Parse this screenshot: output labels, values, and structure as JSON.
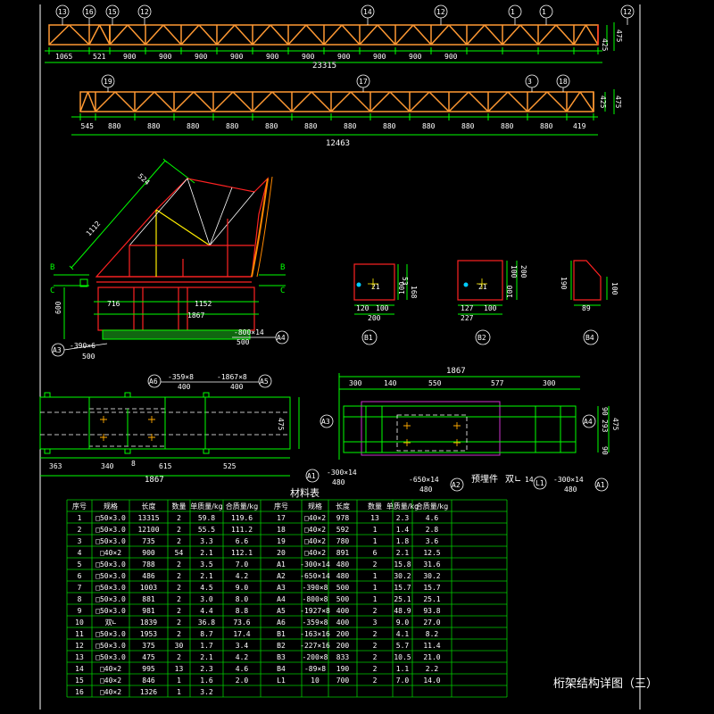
{
  "title": "桁架结构详图（三）",
  "truss1": {
    "markers": [
      "13",
      "16",
      "15",
      "12",
      "14",
      "12",
      "1",
      "1",
      "12"
    ],
    "dims": [
      "1065",
      "521",
      "900",
      "900",
      "900",
      "900",
      "900",
      "900",
      "900",
      "900",
      "900",
      "900"
    ],
    "total": "23315",
    "heights": [
      "425",
      "475"
    ]
  },
  "truss2": {
    "markers": [
      "19",
      "17",
      "3",
      "18"
    ],
    "dims": [
      "545",
      "880",
      "880",
      "880",
      "880",
      "880",
      "880",
      "880",
      "880",
      "880",
      "880",
      "880",
      "880",
      "419"
    ],
    "total": "12463",
    "heights": [
      "425",
      "475"
    ]
  },
  "side_view": {
    "dims": [
      "524",
      "1112",
      "716",
      "1152",
      "1867",
      "600"
    ],
    "labels": [
      "B",
      "B",
      "C",
      "C"
    ],
    "notes": [
      "-390×6",
      "500",
      "-800×14",
      "500"
    ],
    "tags": [
      "A3",
      "A4"
    ]
  },
  "details": {
    "b1": {
      "label": "B1",
      "dims": [
        "53",
        "168",
        "100",
        "120",
        "100",
        "200"
      ],
      "hole": "21"
    },
    "b2": {
      "label": "B2",
      "dims": [
        "100",
        "200",
        "100",
        "127",
        "100",
        "227"
      ],
      "hole": "21"
    },
    "b4": {
      "label": "B4",
      "dims": [
        "190",
        "100",
        "89"
      ]
    }
  },
  "plan_left": {
    "top_notes": [
      "A6",
      "-359×8",
      "400",
      "-1867×8",
      "400",
      "A5"
    ],
    "dims": [
      "363",
      "340",
      "8",
      "615",
      "525"
    ],
    "total": "1867",
    "height": "475"
  },
  "plan_right": {
    "dims": [
      "300",
      "140",
      "550",
      "577",
      "300"
    ],
    "total": "1867",
    "side": [
      "90",
      "293",
      "90",
      "475"
    ],
    "tags": [
      "A3",
      "A4",
      "A1",
      "A2",
      "L1",
      "A1"
    ],
    "notes": [
      "-300×14",
      "480",
      "-650×14",
      "480",
      "预埋件",
      "双∟",
      "14",
      "-300×14",
      "480"
    ]
  },
  "table": {
    "title": "材料表",
    "headers": [
      "序号",
      "规格",
      "长度",
      "数量",
      "单质量/kg",
      "合质量/kg",
      "序号",
      "规格",
      "长度",
      "数量",
      "单质量/kg",
      "合质量/kg"
    ],
    "rows": [
      [
        "1",
        "□50×3.0",
        "13315",
        "2",
        "59.8",
        "119.6",
        "17",
        "□40×2",
        "978",
        "13",
        "2.3",
        "4.6"
      ],
      [
        "2",
        "□50×3.0",
        "12100",
        "2",
        "55.5",
        "111.2",
        "18",
        "□40×2",
        "592",
        "1",
        "1.4",
        "2.8"
      ],
      [
        "3",
        "□50×3.0",
        "735",
        "2",
        "3.3",
        "6.6",
        "19",
        "□40×2",
        "780",
        "1",
        "1.8",
        "3.6"
      ],
      [
        "4",
        "□40×2",
        "900",
        "54",
        "2.1",
        "112.1",
        "20",
        "□40×2",
        "891",
        "6",
        "2.1",
        "12.5"
      ],
      [
        "5",
        "□50×3.0",
        "788",
        "2",
        "3.5",
        "7.0",
        "A1",
        "-300×14",
        "480",
        "2",
        "15.8",
        "31.6"
      ],
      [
        "6",
        "□50×3.0",
        "486",
        "2",
        "2.1",
        "4.2",
        "A2",
        "-650×14",
        "480",
        "1",
        "30.2",
        "30.2"
      ],
      [
        "7",
        "□50×3.0",
        "1003",
        "2",
        "4.5",
        "9.0",
        "A3",
        "-390×8",
        "500",
        "1",
        "15.7",
        "15.7"
      ],
      [
        "8",
        "□50×3.0",
        "881",
        "2",
        "3.0",
        "8.0",
        "A4",
        "-800×8",
        "500",
        "1",
        "25.1",
        "25.1"
      ],
      [
        "9",
        "□50×3.0",
        "981",
        "2",
        "4.4",
        "8.8",
        "A5",
        "-1927×8",
        "400",
        "2",
        "48.9",
        "93.8"
      ],
      [
        "10",
        "双∟",
        "1839",
        "2",
        "36.8",
        "73.6",
        "A6",
        "-359×8",
        "400",
        "3",
        "9.0",
        "27.0"
      ],
      [
        "11",
        "□50×3.0",
        "1953",
        "2",
        "8.7",
        "17.4",
        "B1",
        "-163×16",
        "200",
        "2",
        "4.1",
        "8.2"
      ],
      [
        "12",
        "□50×3.0",
        "375",
        "30",
        "1.7",
        "3.4",
        "B2",
        "-227×16",
        "200",
        "2",
        "5.7",
        "11.4"
      ],
      [
        "13",
        "□50×3.0",
        "475",
        "2",
        "2.1",
        "4.2",
        "B3",
        "-200×8",
        "833",
        "2",
        "10.5",
        "21.0"
      ],
      [
        "14",
        "□40×2",
        "995",
        "13",
        "2.3",
        "4.6",
        "B4",
        "-89×8",
        "190",
        "2",
        "1.1",
        "2.2"
      ],
      [
        "15",
        "□40×2",
        "846",
        "1",
        "1.6",
        "2.0",
        "L1",
        "10",
        "700",
        "2",
        "7.0",
        "14.0"
      ],
      [
        "16",
        "□40×2",
        "1326",
        "1",
        "3.2",
        "",
        "",
        "",
        "",
        "",
        "",
        ""
      ]
    ]
  }
}
